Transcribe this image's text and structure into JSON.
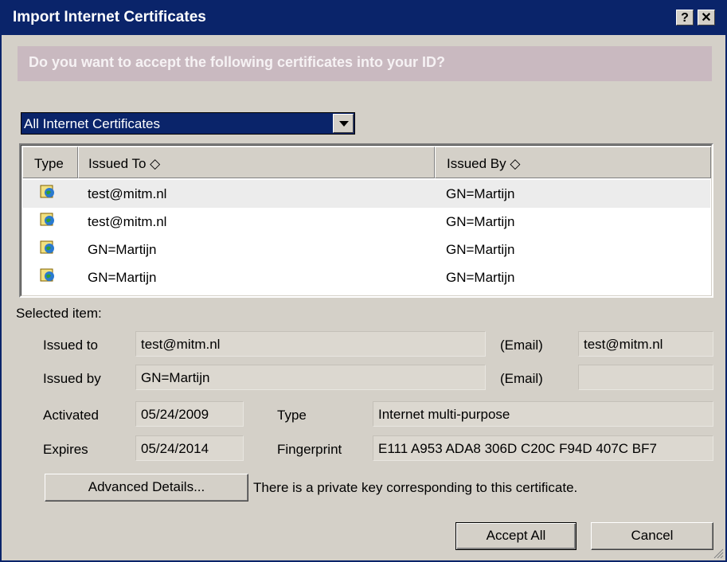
{
  "window": {
    "title": "Import Internet Certificates",
    "help_label": "?",
    "close_label": "✕"
  },
  "prompt": "Do you want to accept the following certificates into your ID?",
  "filter": {
    "selected": "All Internet Certificates"
  },
  "table": {
    "columns": {
      "type": "Type",
      "issued_to": "Issued To ◇",
      "issued_by": "Issued By ◇"
    },
    "rows": [
      {
        "icon": "certificate-globe-icon",
        "issued_to": "test@mitm.nl",
        "issued_by": "GN=Martijn",
        "selected": true
      },
      {
        "icon": "certificate-globe-icon",
        "issued_to": "test@mitm.nl",
        "issued_by": "GN=Martijn",
        "selected": false
      },
      {
        "icon": "certificate-globe-icon",
        "issued_to": "GN=Martijn",
        "issued_by": "GN=Martijn",
        "selected": false
      },
      {
        "icon": "certificate-globe-icon",
        "issued_to": "GN=Martijn",
        "issued_by": "GN=Martijn",
        "selected": false
      }
    ]
  },
  "details": {
    "section_label": "Selected item:",
    "issued_to_label": "Issued to",
    "issued_to_value": "test@mitm.nl",
    "issued_to_email_label": "(Email)",
    "issued_to_email_value": "test@mitm.nl",
    "issued_by_label": "Issued by",
    "issued_by_value": "GN=Martijn",
    "issued_by_email_label": "(Email)",
    "issued_by_email_value": "",
    "activated_label": "Activated",
    "activated_value": "05/24/2009",
    "type_label": "Type",
    "type_value": "Internet multi-purpose",
    "expires_label": "Expires",
    "expires_value": "05/24/2014",
    "fingerprint_label": "Fingerprint",
    "fingerprint_value": "E111 A953 ADA8 306D C20C F94D 407C BF7",
    "advanced_label": "Advanced Details...",
    "private_key_note": "There is a private key corresponding to this certificate."
  },
  "buttons": {
    "accept_all": "Accept All",
    "cancel": "Cancel"
  },
  "colors": {
    "titlebar": "#0a246a",
    "dialog_bg": "#d4d0c8",
    "prompt_bg": "#c9b9c0",
    "selected_row": "#ececec"
  }
}
